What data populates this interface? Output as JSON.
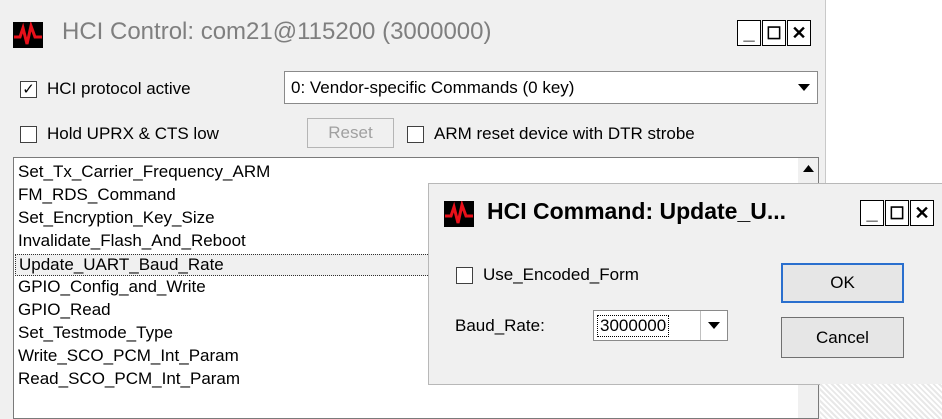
{
  "main_window": {
    "title": "HCI Control: com21@115200 (3000000)",
    "title_buttons": {
      "minimize": "_",
      "maximize": "☐",
      "close": "✕"
    },
    "protocol_checkbox": {
      "label": "HCI protocol active",
      "checked": true,
      "mark": "✓"
    },
    "command_set": {
      "selected": "0: Vendor-specific Commands (0 key)"
    },
    "hold_checkbox": {
      "label": "Hold UPRX & CTS low",
      "checked": false
    },
    "reset_button": {
      "label": "Reset",
      "enabled": false
    },
    "arm_checkbox": {
      "label": "ARM reset device with DTR strobe",
      "checked": false
    },
    "commands": [
      "Set_Tx_Carrier_Frequency_ARM",
      "FM_RDS_Command",
      "Set_Encryption_Key_Size",
      "Invalidate_Flash_And_Reboot",
      "Update_UART_Baud_Rate",
      "GPIO_Config_and_Write",
      "GPIO_Read",
      "Set_Testmode_Type",
      "Write_SCO_PCM_Int_Param",
      "Read_SCO_PCM_Int_Param"
    ],
    "selected_command": "Update_UART_Baud_Rate"
  },
  "dialog": {
    "title": "HCI Command: Update_U...",
    "title_buttons": {
      "minimize": "_",
      "maximize": "☐",
      "close": "✕"
    },
    "encoded_checkbox": {
      "label": "Use_Encoded_Form",
      "checked": false
    },
    "baud_label": "Baud_Rate:",
    "baud_value": "3000000",
    "ok_label": "OK",
    "cancel_label": "Cancel"
  },
  "icons": {
    "combo_arrow": "chevron-down-icon",
    "scroll_up": "scroll-up-arrow-icon",
    "app_logo": "waveform-logo-icon"
  },
  "colors": {
    "title_inactive": "#7f7f7f",
    "title_active": "#000000",
    "logo_wave": "#e8101a"
  }
}
